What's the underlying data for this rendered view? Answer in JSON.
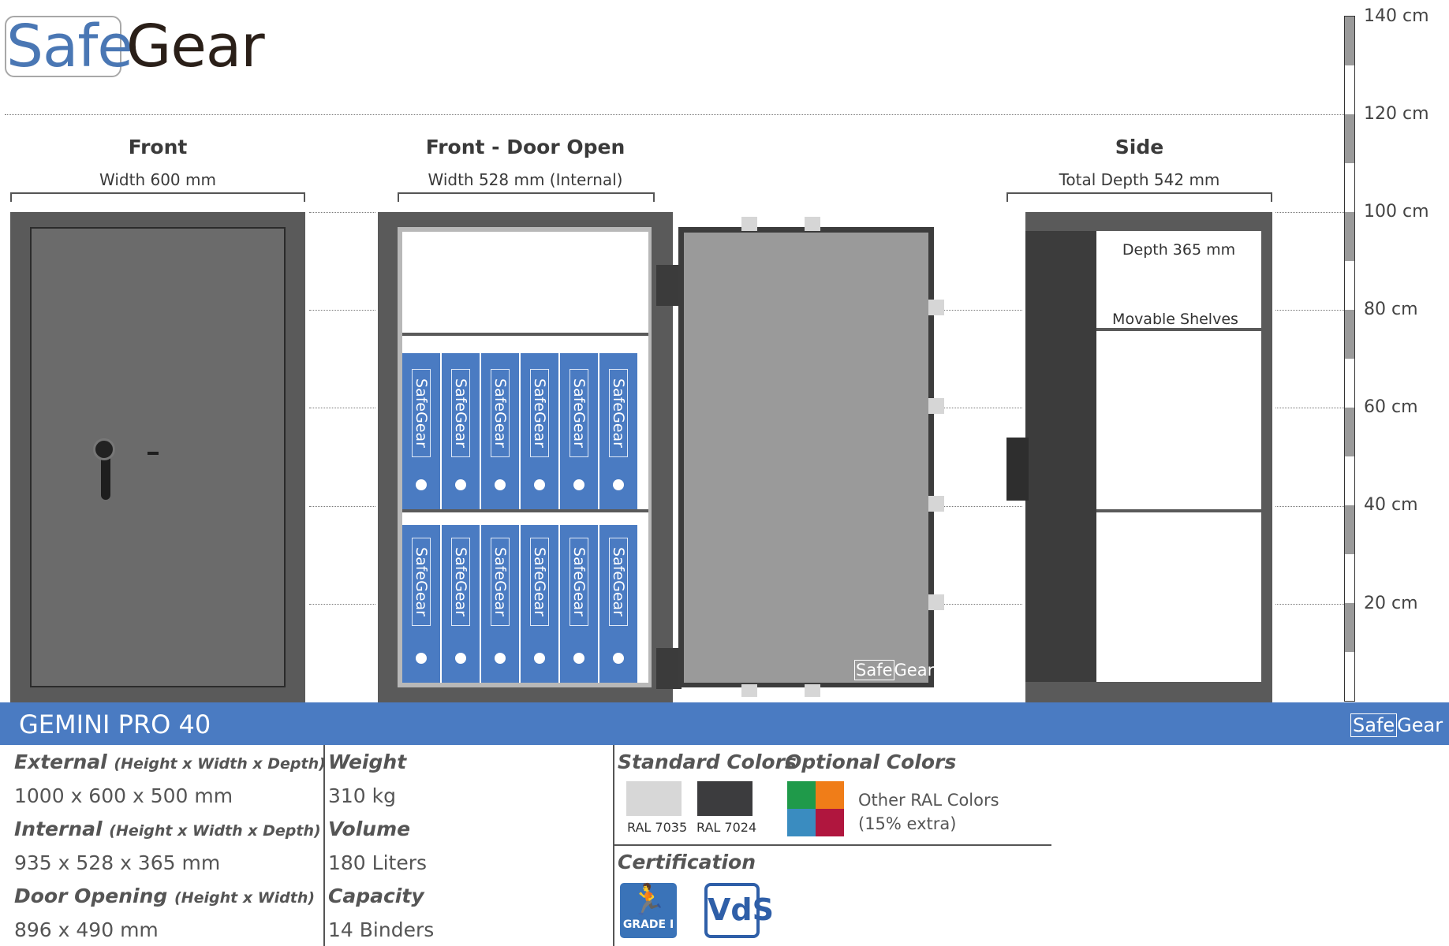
{
  "brand": {
    "logo_left": "Safe",
    "logo_right": "Gear"
  },
  "views": {
    "front": {
      "title": "Front",
      "subtitle": "Width 600 mm"
    },
    "front_open": {
      "title": "Front - Door Open",
      "subtitle": "Width 528 mm (Internal)"
    },
    "side": {
      "title": "Side",
      "subtitle": "Total Depth 542 mm",
      "depth_label": "Depth 365 mm",
      "shelves_label": "Movable Shelves"
    }
  },
  "ruler": {
    "labels": [
      "140 cm",
      "120 cm",
      "100 cm",
      "80 cm",
      "60 cm",
      "40 cm",
      "20 cm"
    ]
  },
  "binders": {
    "label_left": "Safe",
    "label_right": "Gear",
    "count": 14
  },
  "door_logo": {
    "left": "Safe",
    "right": "Gear"
  },
  "product": {
    "name": "GEMINI PRO 40",
    "logo_left": "Safe",
    "logo_right": "Gear"
  },
  "specs": {
    "external": {
      "label": "External",
      "hint": "(Height x Width x Depth)",
      "value": "1000 x 600 x 500 mm"
    },
    "internal": {
      "label": "Internal",
      "hint": "(Height x Width x Depth)",
      "value": "935 x 528 x 365 mm"
    },
    "door_opening": {
      "label": "Door Opening",
      "hint": "(Height x Width)",
      "value": "896 x 490 mm"
    },
    "weight": {
      "label": "Weight",
      "value": "310 kg"
    },
    "volume": {
      "label": "Volume",
      "value": "180 Liters"
    },
    "capacity": {
      "label": "Capacity",
      "value": "14 Binders"
    }
  },
  "colors": {
    "standard_heading": "Standard Colors",
    "optional_heading": "Optional Colors",
    "standard": [
      {
        "name": "RAL 7035",
        "hex": "#d7d7d7"
      },
      {
        "name": "RAL 7024",
        "hex": "#3c3c3e"
      }
    ],
    "optional_swatch": [
      "#1f9a4a",
      "#f07d18",
      "#3a8cc0",
      "#b0163e"
    ],
    "optional_line1": "Other RAL Colors",
    "optional_line2": "(15% extra)"
  },
  "certification": {
    "heading": "Certification",
    "grade_label": "GRADE I",
    "vds_label": "VdS"
  }
}
